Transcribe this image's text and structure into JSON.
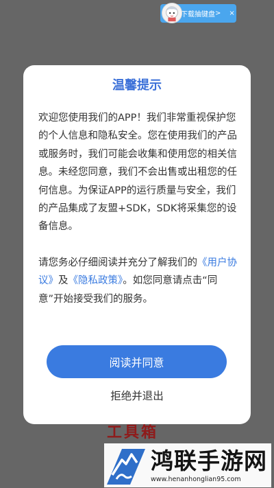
{
  "ad": {
    "label": "下载抽键盘",
    "chevron": ">",
    "close": "×"
  },
  "background": {
    "text": "工具箱"
  },
  "dialog": {
    "title": "温馨提示",
    "paragraph1": "欢迎您使用我们的APP！我们非常重视保护您的个人信息和隐私安全。您在使用我们的产品或服务时，我们可能会收集和使用您的相关信息。未经您同意，我们不会出售或出租您的任何信息。为保证APP的运行质量与安全，我们的产品集成了友盟+SDK，SDK将采集您的设备信息。",
    "p2_before": "请您务必仔细阅读并充分了解我们的",
    "link_user_agreement": "《用户协议》",
    "p2_and": "及",
    "link_privacy_policy": "《隐私政策》",
    "p2_after": "。如您同意请点击“同意”开始接受我们的服务。",
    "agree_label": "阅读并同意",
    "exit_label": "拒绝并退出"
  },
  "brand": {
    "name": "鸿联手游网",
    "url": "www.henanhonglian95.com"
  },
  "colors": {
    "accent": "#3a7be0",
    "title": "#3a6fd8",
    "overlay": "#666666"
  }
}
